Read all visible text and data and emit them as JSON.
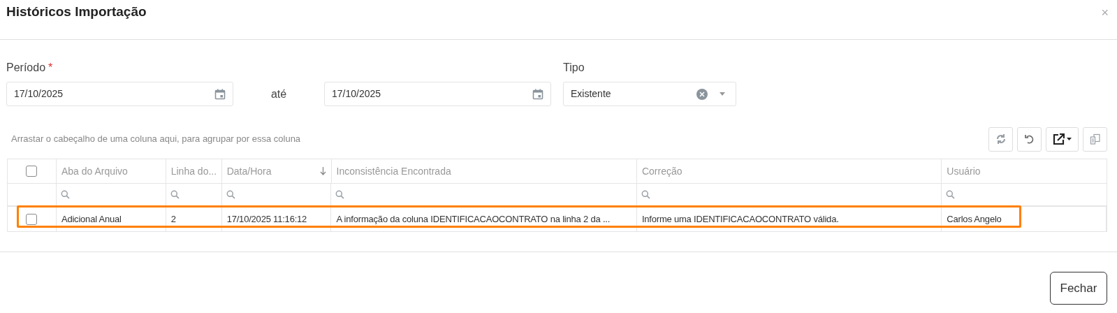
{
  "dialog": {
    "title": "Históricos Importação",
    "close_icon": "×"
  },
  "filters": {
    "period": {
      "label": "Período",
      "required_marker": "*",
      "from": "17/10/2025",
      "separator": "até",
      "to": "17/10/2025"
    },
    "type": {
      "label": "Tipo",
      "value": "Existente"
    }
  },
  "group_hint": "Arrastar o cabeçalho de uma coluna aqui, para agrupar por essa coluna",
  "table": {
    "select_all_checked": false,
    "columns": [
      {
        "label": "Aba do Arquivo",
        "sorted": false
      },
      {
        "label": "Linha do...",
        "sorted": false
      },
      {
        "label": "Data/Hora",
        "sorted": true
      },
      {
        "label": "Inconsistência Encontrada",
        "sorted": false
      },
      {
        "label": "Correção",
        "sorted": false
      },
      {
        "label": "Usuário",
        "sorted": false
      }
    ],
    "rows": [
      {
        "checked": false,
        "highlighted": true,
        "cells": [
          "Adicional Anual",
          "2",
          "17/10/2025 11:16:12",
          "A informação da coluna IDENTIFICACAOCONTRATO na linha 2 da ...",
          "Informe uma IDENTIFICACAOCONTRATO válida.",
          "Carlos Angelo"
        ]
      }
    ]
  },
  "footer": {
    "close_button": "Fechar"
  }
}
